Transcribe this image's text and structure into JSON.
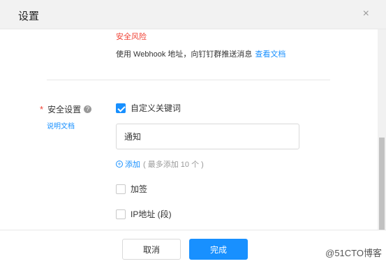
{
  "header": {
    "title": "设置",
    "close_glyph": "×"
  },
  "top": {
    "risk_link": "安全风险",
    "webhook_text": "使用 Webhook 地址，向钉钉群推送消息",
    "doc_link": "查看文档"
  },
  "security": {
    "required_mark": "*",
    "label": "安全设置",
    "help_glyph": "?",
    "doc_link": "说明文档",
    "options": [
      {
        "label": "自定义关键词",
        "checked": true
      },
      {
        "label": "加签",
        "checked": false
      },
      {
        "label": "IP地址 (段)",
        "checked": false
      }
    ],
    "keyword_value": "通知",
    "add_plus": "+",
    "add_label": "添加",
    "add_hint": "( 最多添加 10 个 )"
  },
  "footer": {
    "cancel_label": "取消",
    "ok_label": "完成"
  },
  "watermark": "@51CTO博客",
  "colors": {
    "accent": "#1890ff",
    "danger": "#f04134",
    "header_bg": "#f2f2f2"
  }
}
